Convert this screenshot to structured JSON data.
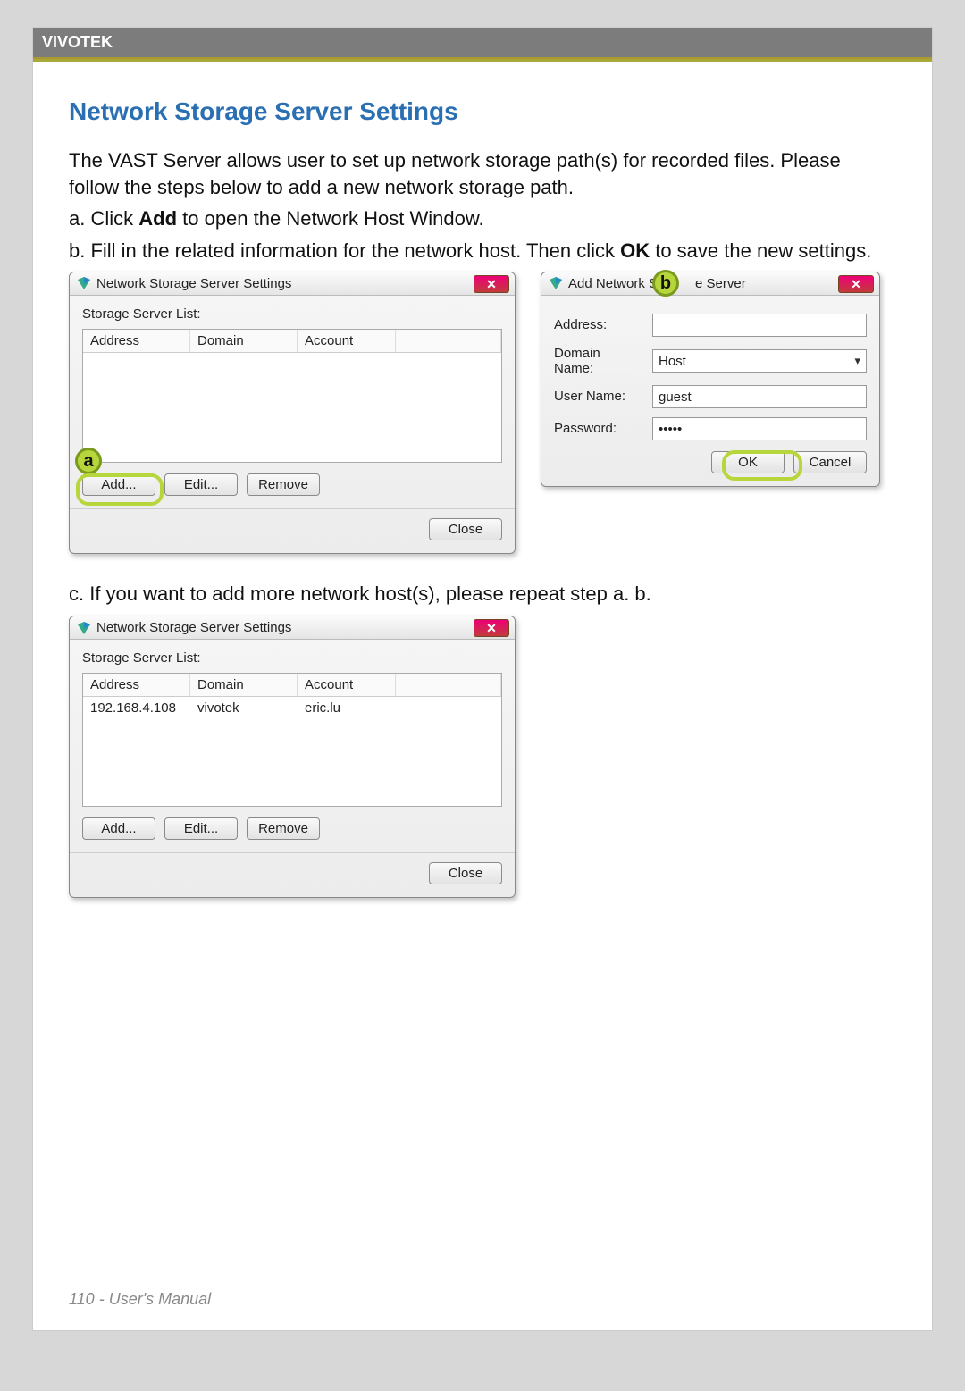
{
  "header": {
    "brand": "VIVOTEK"
  },
  "section": {
    "title": "Network Storage Server Settings",
    "p1": "The VAST Server allows user to set up network storage path(s) for recorded files. Please follow the steps below to add a new network storage path.",
    "p2a": "a. Click ",
    "p2b": "Add",
    "p2c": " to open the Network Host Window.",
    "p3a": "b. Fill in the related information for the network host. Then click ",
    "p3b": "OK",
    "p3c": " to save the new settings.",
    "p4": "c. If you want to add more network host(s), please repeat step a. b."
  },
  "win_settings": {
    "title": "Network Storage Server Settings",
    "list_label": "Storage Server List:",
    "cols": {
      "address": "Address",
      "domain": "Domain",
      "account": "Account"
    },
    "buttons": {
      "add": "Add...",
      "edit": "Edit...",
      "remove": "Remove",
      "close": "Close"
    }
  },
  "win_add": {
    "title_left": "Add Network S",
    "title_right": "e Server",
    "fields": {
      "address_label": "Address:",
      "address_value": "",
      "domain_label": "Domain Name:",
      "domain_value": "Host",
      "user_label": "User Name:",
      "user_value": "guest",
      "password_label": "Password:",
      "password_value": "•••••"
    },
    "buttons": {
      "ok": "OK",
      "cancel": "Cancel"
    }
  },
  "win_settings2": {
    "rows": [
      {
        "address": "192.168.4.108",
        "domain": "vivotek",
        "account": "eric.lu"
      }
    ]
  },
  "callouts": {
    "a": "a",
    "b": "b"
  },
  "footer": {
    "text": "110 - User's Manual"
  }
}
